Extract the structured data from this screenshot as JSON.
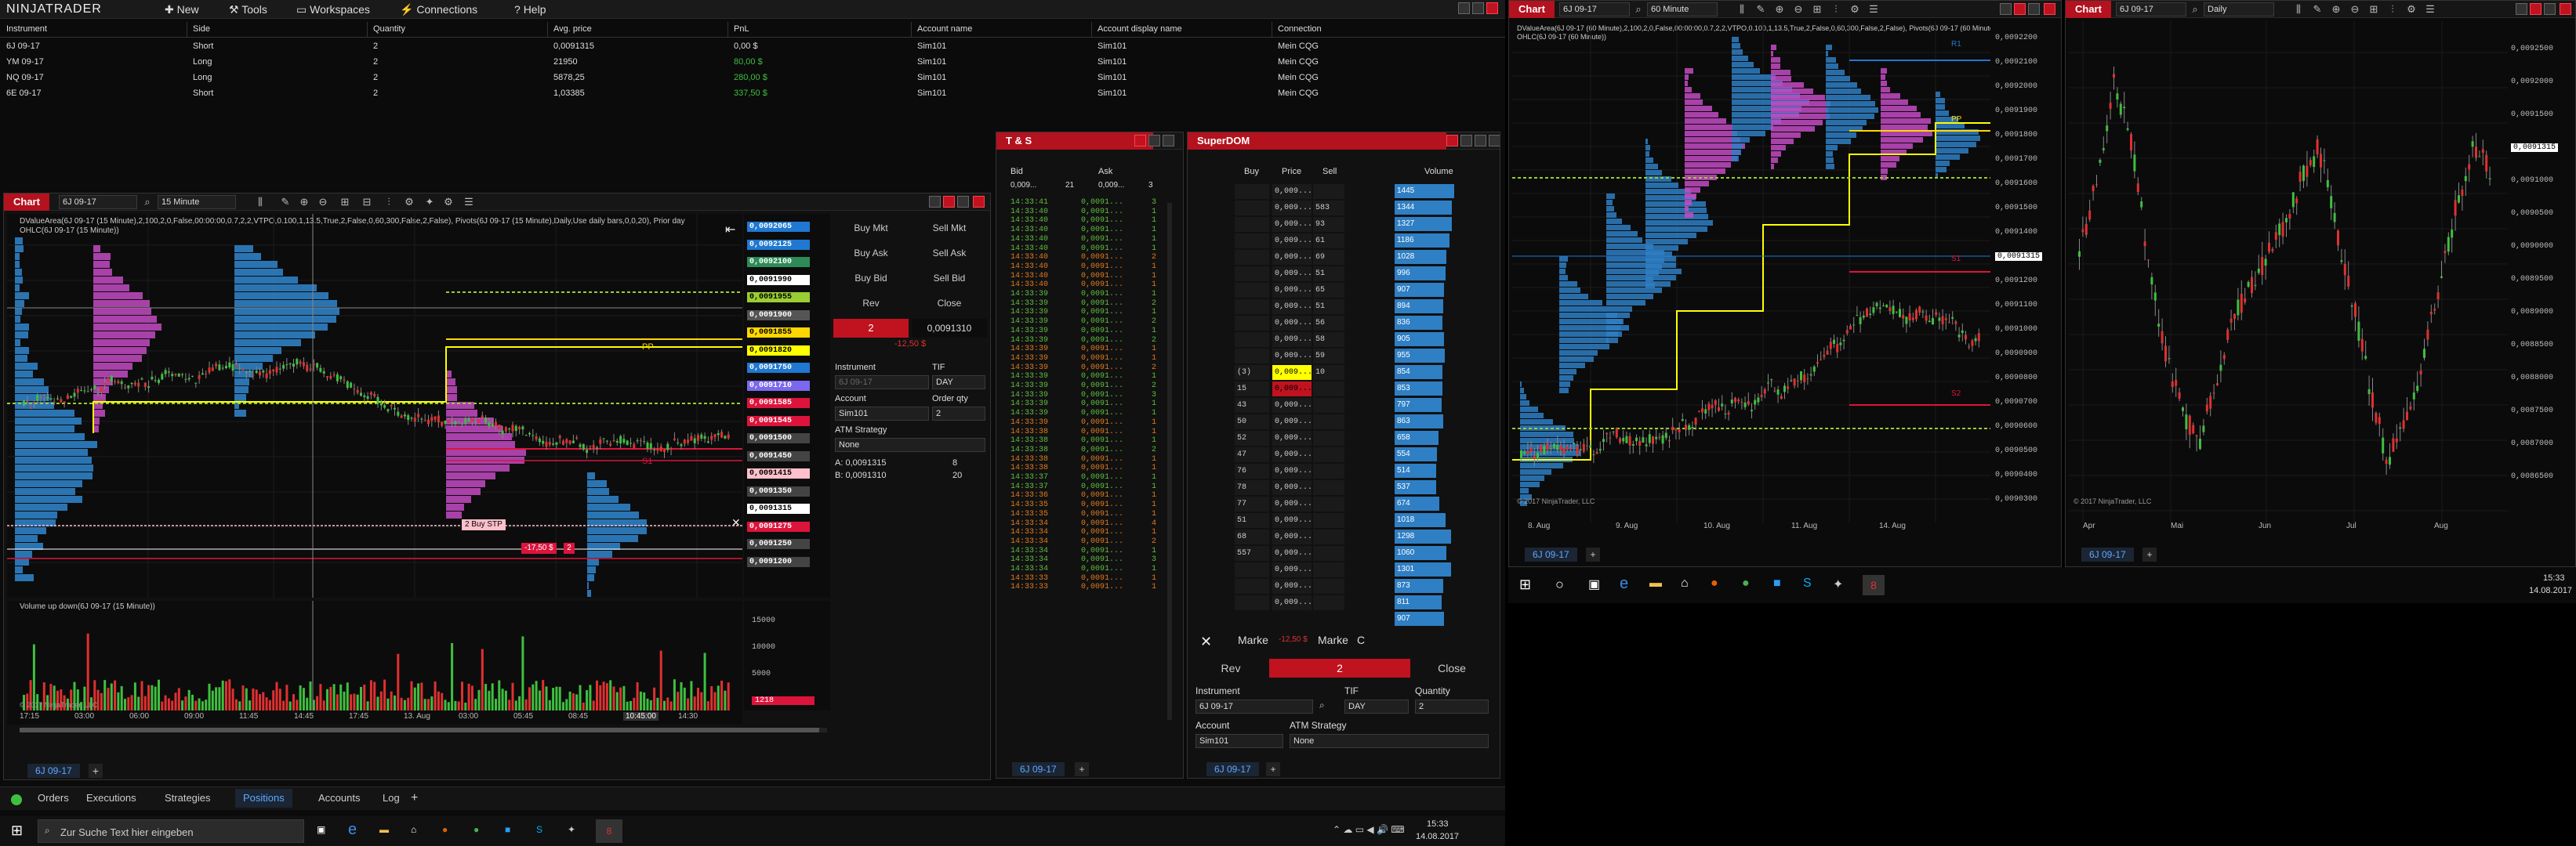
{
  "app": {
    "logo": "NINJATRADER",
    "menu": [
      "New",
      "Tools",
      "Workspaces",
      "Connections",
      "Help"
    ]
  },
  "positions": {
    "headers": [
      "Instrument",
      "Side",
      "Quantity",
      "Avg. price",
      "PnL",
      "Account name",
      "Account display name",
      "Connection"
    ],
    "rows": [
      [
        "6J 09-17",
        "Short",
        "2",
        "0,0091315",
        "0,00 $",
        "Sim101",
        "Sim101",
        "Mein CQG"
      ],
      [
        "YM 09-17",
        "Long",
        "2",
        "21950",
        "80,00 $",
        "Sim101",
        "Sim101",
        "Mein CQG"
      ],
      [
        "NQ 09-17",
        "Long",
        "2",
        "5878,25",
        "280,00 $",
        "Sim101",
        "Sim101",
        "Mein CQG"
      ],
      [
        "6E 09-17",
        "Short",
        "2",
        "1,03385",
        "337,50 $",
        "Sim101",
        "Sim101",
        "Mein CQG"
      ]
    ],
    "pnl_colors": [
      "#dddddd",
      "#3fbf3f",
      "#3fbf3f",
      "#3fbf3f"
    ]
  },
  "chart1": {
    "tab": "Chart",
    "instrument": "6J 09-17",
    "interval": "15 Minute",
    "indicator_text_1": "DValueArea(6J 09-17 (15 Minute),2,100,2,0,False,00:00:00,0.7,2,2,VTPO,0.100,1,13.5,True,2,False,0,60,300,False,2,False), Pivots(6J 09-17 (15 Minute),Daily,Use daily bars,0,0,20), Prior day",
    "indicator_text_2": "OHLC(6J 09-17 (15 Minute))",
    "volume_label": "Volume up down(6J 09-17 (15 Minute))",
    "copyright": "© 2017 NinjaTrader, LLC",
    "price_badges": [
      {
        "label": "0,0092065",
        "bg": "#1f78d1",
        "fg": "#fff"
      },
      {
        "label": "0,0092125",
        "bg": "#1f78d1",
        "fg": "#fff"
      },
      {
        "label": "0,0092100",
        "bg": "#2e8b57",
        "fg": "#fff"
      },
      {
        "label": "0,0091990",
        "bg": "#ffffff",
        "fg": "#000"
      },
      {
        "label": "0,0091955",
        "bg": "#9acd32",
        "fg": "#000"
      },
      {
        "label": "0,0091900",
        "bg": "#555",
        "fg": "#fff"
      },
      {
        "label": "0,0091855",
        "bg": "#ffd700",
        "fg": "#000"
      },
      {
        "label": "0,0091820",
        "bg": "#ffff00",
        "fg": "#000"
      },
      {
        "label": "0,0091750",
        "bg": "#1f78d1",
        "fg": "#fff"
      },
      {
        "label": "0,0091710",
        "bg": "#7b68ee",
        "fg": "#fff"
      },
      {
        "label": "0,0091585",
        "bg": "#dc143c",
        "fg": "#fff"
      },
      {
        "label": "0,0091545",
        "bg": "#dc143c",
        "fg": "#fff"
      },
      {
        "label": "0,0091500",
        "bg": "#444",
        "fg": "#fff"
      },
      {
        "label": "0,0091450",
        "bg": "#444",
        "fg": "#fff"
      },
      {
        "label": "0,0091415",
        "bg": "#ffc0cb",
        "fg": "#000"
      },
      {
        "label": "0,0091350",
        "bg": "#444",
        "fg": "#fff"
      },
      {
        "label": "0,0091315",
        "bg": "#ffffff",
        "fg": "#000"
      },
      {
        "label": "0,0091275",
        "bg": "#dc143c",
        "fg": "#fff"
      },
      {
        "label": "0,0091250",
        "bg": "#444",
        "fg": "#fff"
      },
      {
        "label": "0,0091200",
        "bg": "#444",
        "fg": "#fff"
      }
    ],
    "volume_axis": [
      "15000",
      "10000",
      "5000",
      "1218"
    ],
    "time_axis": [
      "17:15",
      "03:00",
      "06:00",
      "09:00",
      "11:45",
      "14:45",
      "17:45",
      "13. Aug",
      "03:00",
      "05:45",
      "08:45",
      "10:45:00",
      "14:30"
    ],
    "labels": {
      "pp": "PP",
      "s1": "S1",
      "buy_stp": "2  Buy STP",
      "stop_lbl": "-17,50 $",
      "stop_qty": "2"
    }
  },
  "chart_trader": {
    "buy_mkt": "Buy Mkt",
    "sell_mkt": "Sell Mkt",
    "buy_ask": "Buy Ask",
    "sell_ask": "Sell Ask",
    "buy_bid": "Buy Bid",
    "sell_bid": "Sell Bid",
    "rev": "Rev",
    "close": "Close",
    "position_qty": "2",
    "price": "0,0091310",
    "pnl": "-12,50 $",
    "instrument_lbl": "Instrument",
    "instrument_val": "6J 09-17",
    "tif_lbl": "TIF",
    "tif_val": "DAY",
    "account_lbl": "Account",
    "account_val": "Sim101",
    "qty_lbl": "Order qty",
    "qty_val": "2",
    "atm_lbl": "ATM Strategy",
    "atm_val": "None",
    "ask_lbl": "A:",
    "ask_val": "0,0091315",
    "ask_size": "8",
    "bid_lbl": "B:",
    "bid_val": "0,0091310",
    "bid_size": "20"
  },
  "bottom_tabs": {
    "chart_tab": "6J 09-17",
    "items": [
      "Orders",
      "Executions",
      "Strategies",
      "Positions",
      "Accounts",
      "Log"
    ],
    "active": "Positions"
  },
  "ts": {
    "title": "T & S",
    "bid_hdr": "Bid",
    "ask_hdr": "Ask",
    "bid_val": "0,009...",
    "bid_size": "21",
    "ask_val": "0,009...",
    "ask_size": "3",
    "rows": [
      [
        "14:33:41",
        "0,0091...",
        "3",
        "#5fbf3f"
      ],
      [
        "14:33:40",
        "0,0091...",
        "1",
        "#5fbf3f"
      ],
      [
        "14:33:40",
        "0,0091...",
        "1",
        "#5fbf3f"
      ],
      [
        "14:33:40",
        "0,0091...",
        "1",
        "#5fbf3f"
      ],
      [
        "14:33:40",
        "0,0091...",
        "1",
        "#5fbf3f"
      ],
      [
        "14:33:40",
        "0,0091...",
        "1",
        "#5fbf3f"
      ],
      [
        "14:33:40",
        "0,0091...",
        "2",
        "#e07b1f"
      ],
      [
        "14:33:40",
        "0,0091...",
        "1",
        "#e07b1f"
      ],
      [
        "14:33:40",
        "0,0091...",
        "1",
        "#e07b1f"
      ],
      [
        "14:33:40",
        "0,0091...",
        "1",
        "#e07b1f"
      ],
      [
        "14:33:39",
        "0,0091...",
        "1",
        "#5fbf3f"
      ],
      [
        "14:33:39",
        "0,0091...",
        "2",
        "#5fbf3f"
      ],
      [
        "14:33:39",
        "0,0091...",
        "1",
        "#5fbf3f"
      ],
      [
        "14:33:39",
        "0,0091...",
        "2",
        "#5fbf3f"
      ],
      [
        "14:33:39",
        "0,0091...",
        "1",
        "#5fbf3f"
      ],
      [
        "14:33:39",
        "0,0091...",
        "2",
        "#5fbf3f"
      ],
      [
        "14:33:39",
        "0,0091...",
        "1",
        "#e07b1f"
      ],
      [
        "14:33:39",
        "0,0091...",
        "1",
        "#e07b1f"
      ],
      [
        "14:33:39",
        "0,0091...",
        "2",
        "#e07b1f"
      ],
      [
        "14:33:39",
        "0,0091...",
        "1",
        "#5fbf3f"
      ],
      [
        "14:33:39",
        "0,0091...",
        "2",
        "#5fbf3f"
      ],
      [
        "14:33:39",
        "0,0091...",
        "3",
        "#5fbf3f"
      ],
      [
        "14:33:39",
        "0,0091...",
        "1",
        "#5fbf3f"
      ],
      [
        "14:33:39",
        "0,0091...",
        "1",
        "#5fbf3f"
      ],
      [
        "14:33:39",
        "0,0091...",
        "1",
        "#e07b1f"
      ],
      [
        "14:33:38",
        "0,0091...",
        "1",
        "#e07b1f"
      ],
      [
        "14:33:38",
        "0,0091...",
        "1",
        "#5fbf3f"
      ],
      [
        "14:33:38",
        "0,0091...",
        "2",
        "#5fbf3f"
      ],
      [
        "14:33:38",
        "0,0091...",
        "1",
        "#e07b1f"
      ],
      [
        "14:33:38",
        "0,0091...",
        "1",
        "#e07b1f"
      ],
      [
        "14:33:37",
        "0,0091...",
        "1",
        "#5fbf3f"
      ],
      [
        "14:33:37",
        "0,0091...",
        "1",
        "#5fbf3f"
      ],
      [
        "14:33:36",
        "0,0091...",
        "1",
        "#e07b1f"
      ],
      [
        "14:33:35",
        "0,0091...",
        "1",
        "#e07b1f"
      ],
      [
        "14:33:35",
        "0,0091...",
        "1",
        "#e07b1f"
      ],
      [
        "14:33:34",
        "0,0091...",
        "4",
        "#e07b1f"
      ],
      [
        "14:33:34",
        "0,0091...",
        "1",
        "#e07b1f"
      ],
      [
        "14:33:34",
        "0,0091...",
        "2",
        "#e07b1f"
      ],
      [
        "14:33:34",
        "0,0091...",
        "1",
        "#5fbf3f"
      ],
      [
        "14:33:34",
        "0,0091...",
        "3",
        "#5fbf3f"
      ],
      [
        "14:33:34",
        "0,0091...",
        "1",
        "#5fbf3f"
      ],
      [
        "14:33:33",
        "0,0091...",
        "1",
        "#e07b1f"
      ],
      [
        "14:33:33",
        "0,0091...",
        "1",
        "#e07b1f"
      ]
    ],
    "tab": "6J 09-17"
  },
  "dom": {
    "title": "SuperDOM",
    "hdr_buy": "Buy",
    "hdr_price": "Price",
    "hdr_sell": "Sell",
    "hdr_volume": "Volume",
    "rows": [
      [
        "",
        "0,009...",
        "",
        ""
      ],
      [
        "",
        "0,009...",
        "583",
        ""
      ],
      [
        "",
        "0,009...",
        "93",
        ""
      ],
      [
        "",
        "0,009...",
        "61",
        ""
      ],
      [
        "",
        "0,009...",
        "69",
        ""
      ],
      [
        "",
        "0,009...",
        "51",
        ""
      ],
      [
        "",
        "0,009...",
        "65",
        ""
      ],
      [
        "",
        "0,009...",
        "51",
        ""
      ],
      [
        "",
        "0,009...",
        "56",
        ""
      ],
      [
        "",
        "0,009...",
        "58",
        ""
      ],
      [
        "",
        "0,009...",
        "59",
        ""
      ],
      [
        "(3)",
        "0,009...",
        "10",
        ""
      ],
      [
        "15",
        "0,009...",
        "",
        ""
      ],
      [
        "43",
        "0,009...",
        "",
        ""
      ],
      [
        "50",
        "0,009...",
        "",
        ""
      ],
      [
        "52",
        "0,009...",
        "",
        ""
      ],
      [
        "47",
        "0,009...",
        "",
        ""
      ],
      [
        "76",
        "0,009...",
        "",
        ""
      ],
      [
        "78",
        "0,009...",
        "",
        ""
      ],
      [
        "77",
        "0,009...",
        "",
        ""
      ],
      [
        "51",
        "0,009...",
        "",
        ""
      ],
      [
        "68",
        "0,009...",
        "",
        ""
      ],
      [
        "557",
        "0,009...",
        "",
        ""
      ],
      [
        "",
        "0,009...",
        "",
        ""
      ],
      [
        "",
        "0,009...",
        "",
        ""
      ],
      [
        "",
        "0,009...",
        "",
        ""
      ]
    ],
    "volumes": [
      "1445",
      "1344",
      "1327",
      "1186",
      "1028",
      "996",
      "907",
      "894",
      "836",
      "905",
      "955",
      "854",
      "853",
      "797",
      "863",
      "658",
      "554",
      "514",
      "537",
      "674",
      "1018",
      "1298",
      "1060",
      "1301",
      "873",
      "811",
      "907"
    ],
    "mkt_lbl": "Marke",
    "mkt_pnl": "-12,50 $",
    "mkt_lbl2": "Marke",
    "mkt_c": "C",
    "rev": "Rev",
    "qty": "2",
    "close": "Close",
    "instrument_lbl": "Instrument",
    "instrument_val": "6J 09-17",
    "tif_lbl": "TIF",
    "tif_val": "DAY",
    "quantity_lbl": "Quantity",
    "quantity_val": "2",
    "account_lbl": "Account",
    "account_val": "Sim101",
    "atm_lbl": "ATM Strategy",
    "atm_val": "None",
    "tab": "6J 09-17"
  },
  "chart2": {
    "tab": "Chart",
    "instrument": "6J 09-17",
    "interval": "60 Minute",
    "indicator_text_1": "DValueArea(6J 09-17 (60 Minute),2,100,2,0,False,00:00:00,0.7,2,2,VTPO,0.100,1,13.5,True,2,False,0,60,300,False,2,False), Pivots(6J 09-17 (60 Minute),Daily,Use daily bars,0,0,20), Prior day",
    "indicator_text_2": "OHLC(6J 09-17 (60 Minute))",
    "axis": [
      "0,0092200",
      "0,0092100",
      "0,0092000",
      "0,0091900",
      "0,0091800",
      "0,0091700",
      "0,0091600",
      "0,0091500",
      "0,0091400",
      "0,0091315",
      "0,0091200",
      "0,0091100",
      "0,0091000",
      "0,0090900",
      "0,0090800",
      "0,0090700",
      "0,0090600",
      "0,0090500",
      "0,0090400",
      "0,0090300"
    ],
    "dates": [
      "8. Aug",
      "9. Aug",
      "10. Aug",
      "11. Aug",
      "14. Aug"
    ],
    "copyright": "© 2017 NinjaTrader, LLC",
    "labels": {
      "r1": "R1",
      "pp": "PP",
      "s1": "S1",
      "s2": "S2"
    },
    "tab_bottom": "6J 09-17"
  },
  "chart3": {
    "tab": "Chart",
    "instrument": "6J 09-17",
    "interval": "Daily",
    "axis": [
      "0,0092500",
      "0,0092000",
      "0,0091500",
      "0,0091315",
      "0,0091000",
      "0,0090500",
      "0,0090000",
      "0,0089500",
      "0,0089000",
      "0,0088500",
      "0,0088000",
      "0,0087500",
      "0,0087000",
      "0,0086500"
    ],
    "dates": [
      "Apr",
      "Mai",
      "Jun",
      "Jul",
      "Aug"
    ],
    "copyright": "© 2017 NinjaTrader, LLC",
    "tab_bottom": "6J 09-17"
  },
  "taskbar": {
    "search_placeholder": "Zur Suche Text hier eingeben",
    "time": "15:33",
    "date": "14.08.2017"
  },
  "colors": {
    "accent_red": "#c1121f",
    "up": "#3fbf3f",
    "down": "#e03030",
    "profile_blue": "#2f7fc4",
    "profile_magenta": "#c44bc4"
  }
}
